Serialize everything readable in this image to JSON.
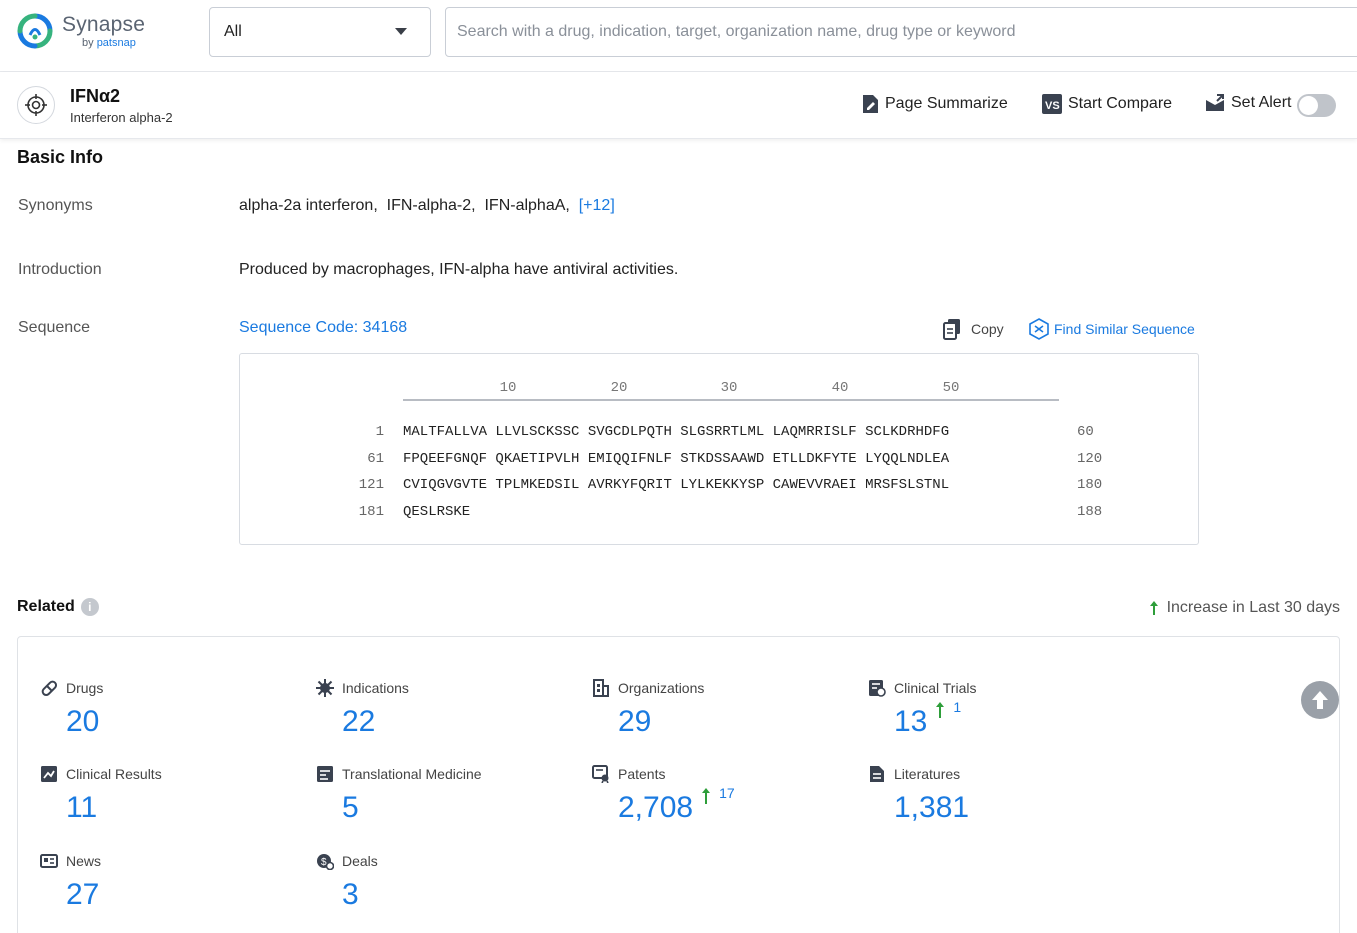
{
  "brand": {
    "name": "Synapse",
    "by": "by",
    "company": "patsnap"
  },
  "search": {
    "scope_selected": "All",
    "placeholder": "Search with a drug, indication, target, organization name, drug type or keyword"
  },
  "target": {
    "title": "IFNα2",
    "subtitle": "Interferon alpha-2"
  },
  "actions": {
    "summarize": "Page Summarize",
    "compare": "Start Compare",
    "alert": "Set Alert",
    "alert_on": false
  },
  "basic_info": {
    "title": "Basic Info",
    "synonyms_label": "Synonyms",
    "synonyms": [
      "alpha-2a interferon,",
      "IFN-alpha-2,",
      "IFN-alphaA,"
    ],
    "synonyms_more": "[+12]",
    "introduction_label": "Introduction",
    "introduction": "Produced by macrophages, IFN-alpha have antiviral activities.",
    "sequence_label": "Sequence",
    "sequence_code": "Sequence Code: 34168",
    "copy_label": "Copy",
    "find_similar_label": "Find Similar Sequence"
  },
  "sequence": {
    "ruler": [
      "10",
      "20",
      "30",
      "40",
      "50"
    ],
    "rows": [
      {
        "start": "1",
        "text": "MALTFALLVA LLVLSCKSSC SVGCDLPQTH SLGSRRTLML LAQMRRISLF SCLKDRHDFG",
        "end": "60"
      },
      {
        "start": "61",
        "text": "FPQEEFGNQF QKAETIPVLH EMIQQIFNLF STKDSSAAWD ETLLDKFYTE LYQQLNDLEA",
        "end": "120"
      },
      {
        "start": "121",
        "text": "CVIQGVGVTE TPLMKEDSIL AVRKYFQRIT LYLKEKKYSP CAWEVVRAEI MRSFSLSTNL",
        "end": "180"
      },
      {
        "start": "181",
        "text": "QESLRSKE",
        "end": "188"
      }
    ]
  },
  "related": {
    "title": "Related",
    "increase_note": "Increase in Last 30 days",
    "stats": [
      {
        "label": "Drugs",
        "value": "20",
        "increase": ""
      },
      {
        "label": "Indications",
        "value": "22",
        "increase": ""
      },
      {
        "label": "Organizations",
        "value": "29",
        "increase": ""
      },
      {
        "label": "Clinical Trials",
        "value": "13",
        "increase": "1"
      },
      {
        "label": "Clinical Results",
        "value": "11",
        "increase": ""
      },
      {
        "label": "Translational Medicine",
        "value": "5",
        "increase": ""
      },
      {
        "label": "Patents",
        "value": "2,708",
        "increase": "17"
      },
      {
        "label": "Literatures",
        "value": "1,381",
        "increase": ""
      },
      {
        "label": "News",
        "value": "27",
        "increase": ""
      },
      {
        "label": "Deals",
        "value": "3",
        "increase": ""
      }
    ]
  },
  "colors": {
    "accent": "#1a7ae0",
    "increase_arrow": "#2e9e3a",
    "brand_green": "#36b37e"
  }
}
